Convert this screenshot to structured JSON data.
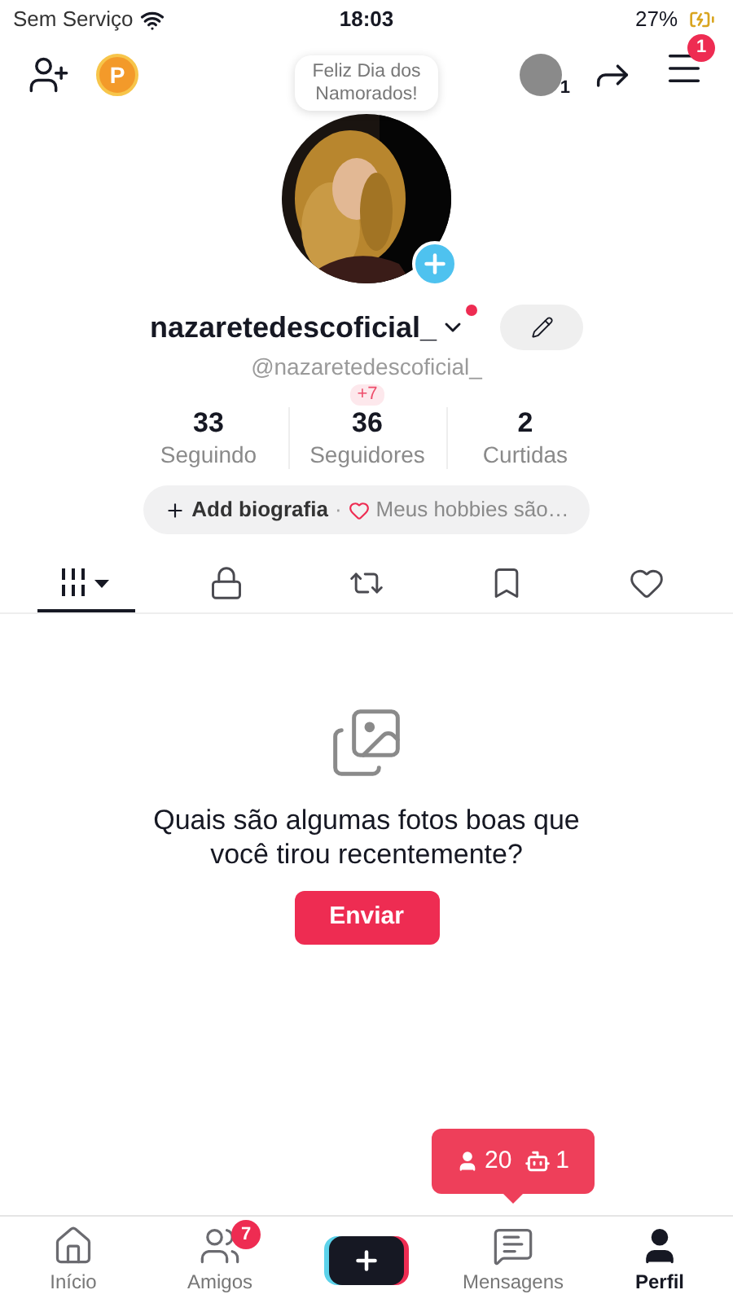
{
  "status_bar": {
    "carrier": "Sem Serviço",
    "time": "18:03",
    "battery": "27%"
  },
  "top_bar": {
    "coin_letter": "P",
    "friends_count": "1",
    "menu_badge": "1"
  },
  "greeting_bubble": {
    "text": "Feliz Dia dos Namorados!"
  },
  "profile": {
    "name": "nazaretedescoficial_",
    "has_notification": true,
    "handle": "@nazaretedescoficial_",
    "stats": [
      {
        "value": "33",
        "label": "Seguindo"
      },
      {
        "value": "36",
        "label": "Seguidores",
        "badge": "+7"
      },
      {
        "value": "2",
        "label": "Curtidas"
      }
    ],
    "bio": {
      "add_label": "Add biografia",
      "separator": "·",
      "hint": "Meus hobbies são…"
    }
  },
  "tabs": [
    {
      "kind": "grid",
      "selected": true
    },
    {
      "kind": "lock",
      "selected": false
    },
    {
      "kind": "repost",
      "selected": false
    },
    {
      "kind": "bookmark",
      "selected": false
    },
    {
      "kind": "heart",
      "selected": false
    }
  ],
  "empty_state": {
    "message": "Quais são algumas fotos boas que você tirou recentemente?",
    "button": "Enviar"
  },
  "popup": {
    "followers": "20",
    "bots": "1"
  },
  "nav": [
    {
      "kind": "home",
      "label": "Início",
      "selected": false
    },
    {
      "kind": "friends",
      "label": "Amigos",
      "selected": false,
      "badge": "7"
    },
    {
      "kind": "create"
    },
    {
      "kind": "messages",
      "label": "Mensagens",
      "selected": false
    },
    {
      "kind": "profile",
      "label": "Perfil",
      "selected": true
    }
  ]
}
